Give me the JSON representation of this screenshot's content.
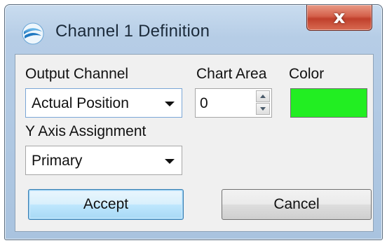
{
  "window": {
    "title": "Channel 1 Definition",
    "close_glyph": "x"
  },
  "form": {
    "output_channel": {
      "label": "Output Channel",
      "value": "Actual Position"
    },
    "chart_area": {
      "label": "Chart Area",
      "value": "0"
    },
    "color": {
      "label": "Color",
      "value": "#22ee22"
    },
    "y_axis": {
      "label": "Y Axis Assignment",
      "value": "Primary"
    }
  },
  "buttons": {
    "accept": "Accept",
    "cancel": "Cancel"
  },
  "icons": {
    "app": "app-logo-icon",
    "close": "close-icon",
    "dropdown": "chevron-down-icon",
    "spin_up": "spin-up-icon",
    "spin_down": "spin-down-icon"
  }
}
